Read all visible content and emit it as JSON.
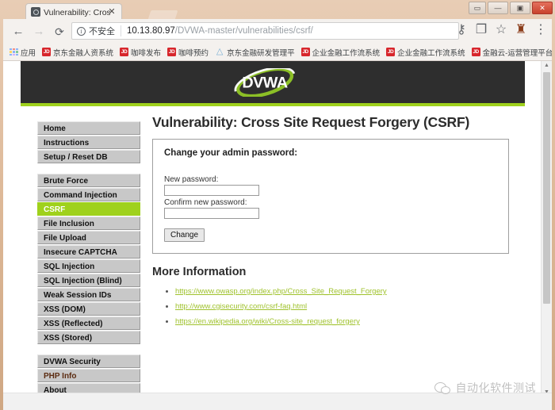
{
  "window": {
    "controls": [
      {
        "name": "restore-down-button",
        "glyph": "▭"
      },
      {
        "name": "minimize-button",
        "glyph": "—"
      },
      {
        "name": "maximize-button",
        "glyph": "▣"
      },
      {
        "name": "close-button",
        "glyph": "✕"
      }
    ]
  },
  "tab": {
    "title": "Vulnerability: Cross Sit",
    "close_glyph": "✕"
  },
  "toolbar": {
    "back_glyph": "←",
    "forward_glyph": "→",
    "reload_glyph": "⟳",
    "security_badge_glyph": "i",
    "security_label": "不安全",
    "url_host": "10.13.80.97",
    "url_path": "/DVWA-master/vulnerabilities/csrf/",
    "icons": [
      {
        "name": "password-key-icon",
        "glyph": "⚷"
      },
      {
        "name": "translate-icon",
        "glyph": "❐"
      },
      {
        "name": "bookmark-star-icon",
        "glyph": "☆"
      },
      {
        "name": "extension-icon",
        "glyph": "♜"
      },
      {
        "name": "chrome-menu-icon",
        "glyph": "⋮"
      }
    ]
  },
  "bookmarks": {
    "apps_label": "应用",
    "items": [
      {
        "label": "京东金融人资系统",
        "icon": "jd-icon"
      },
      {
        "label": "咖啡发布",
        "icon": "jd-icon"
      },
      {
        "label": "咖啡预约",
        "icon": "jd-icon"
      },
      {
        "label": "京东金融研发管理平",
        "icon": "cloud-icon"
      },
      {
        "label": "企业金融工作流系统",
        "icon": "jd-icon"
      },
      {
        "label": "企业金融工作流系统",
        "icon": "jd-icon"
      },
      {
        "label": "金融云-运营管理平台",
        "icon": "jd-icon"
      }
    ],
    "overflow_glyph": "»",
    "jd_text": "JD",
    "cloud_glyph": "△"
  },
  "site": {
    "logo_text": "DVWA",
    "accent_green": "#9fd11c",
    "header_bg": "#2e2e2e"
  },
  "sidebar": {
    "groups": [
      {
        "items": [
          {
            "label": "Home",
            "active": false
          },
          {
            "label": "Instructions",
            "active": false
          },
          {
            "label": "Setup / Reset DB",
            "active": false
          }
        ]
      },
      {
        "items": [
          {
            "label": "Brute Force",
            "active": false
          },
          {
            "label": "Command Injection",
            "active": false
          },
          {
            "label": "CSRF",
            "active": true
          },
          {
            "label": "File Inclusion",
            "active": false
          },
          {
            "label": "File Upload",
            "active": false
          },
          {
            "label": "Insecure CAPTCHA",
            "active": false
          },
          {
            "label": "SQL Injection",
            "active": false
          },
          {
            "label": "SQL Injection (Blind)",
            "active": false
          },
          {
            "label": "Weak Session IDs",
            "active": false
          },
          {
            "label": "XSS (DOM)",
            "active": false
          },
          {
            "label": "XSS (Reflected)",
            "active": false
          },
          {
            "label": "XSS (Stored)",
            "active": false
          }
        ]
      },
      {
        "items": [
          {
            "label": "DVWA Security",
            "active": false
          },
          {
            "label": "PHP Info",
            "active": false,
            "style": "php"
          },
          {
            "label": "About",
            "active": false
          }
        ]
      }
    ]
  },
  "main": {
    "title": "Vulnerability: Cross Site Request Forgery (CSRF)",
    "panel": {
      "heading": "Change your admin password:",
      "fields": [
        {
          "label": "New password:",
          "value": "",
          "placeholder": ""
        },
        {
          "label": "Confirm new password:",
          "value": "",
          "placeholder": ""
        }
      ],
      "submit_label": "Change"
    },
    "more_info_heading": "More Information",
    "links": [
      "https://www.owasp.org/index.php/Cross_Site_Request_Forgery",
      "http://www.cgisecurity.com/csrf-faq.html",
      "https://en.wikipedia.org/wiki/Cross-site_request_forgery"
    ]
  },
  "scrollbar": {
    "up_glyph": "▲",
    "down_glyph": "▼"
  },
  "watermark": {
    "text": "自动化软件测试"
  }
}
